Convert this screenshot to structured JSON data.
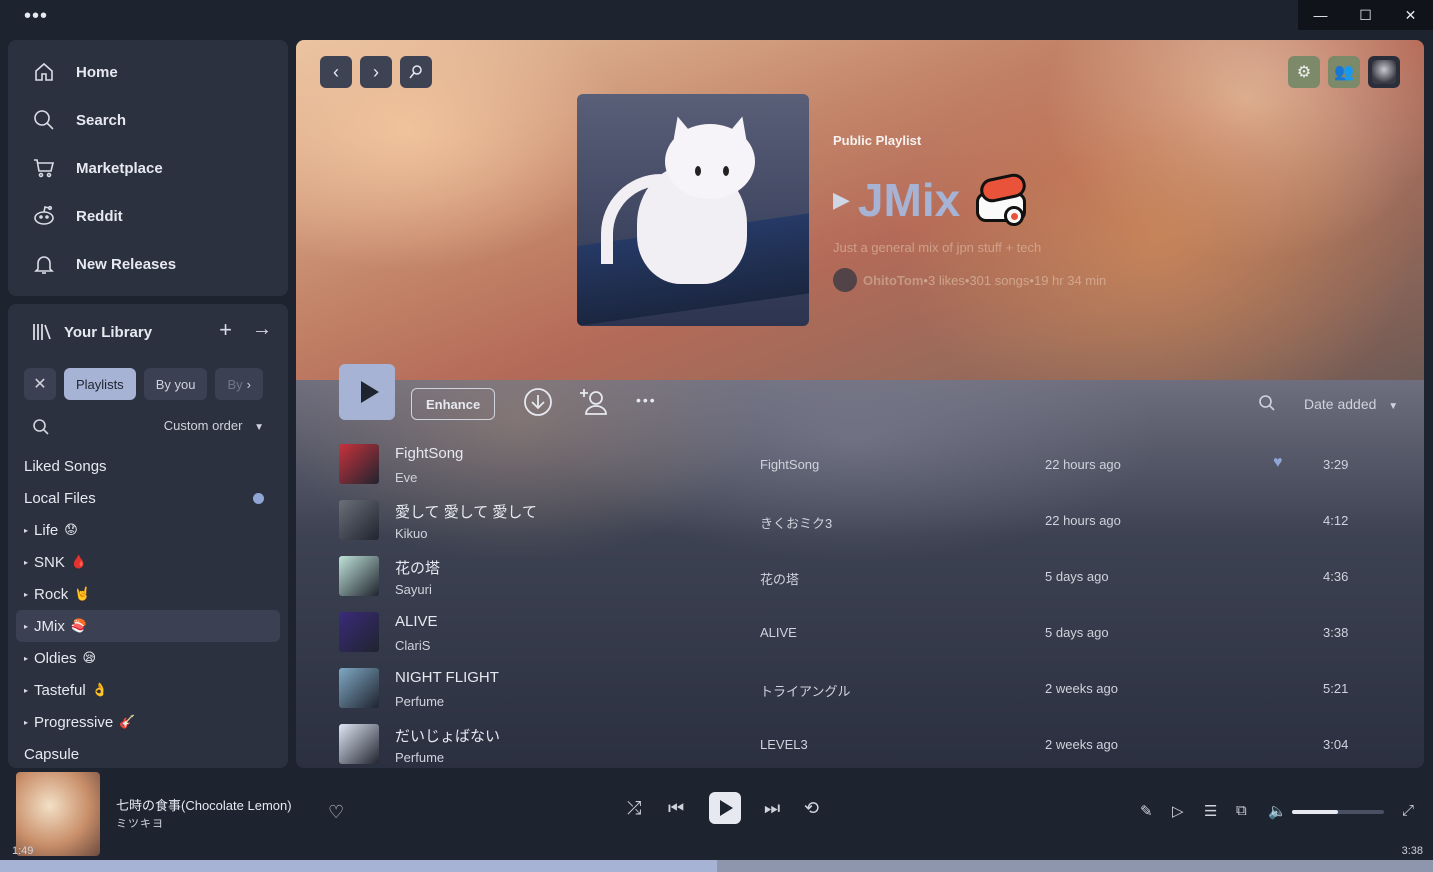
{
  "window": {
    "menu_dots": "•••",
    "minimize": "—",
    "maximize": "☐",
    "close": "✕"
  },
  "nav": [
    {
      "label": "Home",
      "icon": "home-icon"
    },
    {
      "label": "Search",
      "icon": "search-icon"
    },
    {
      "label": "Marketplace",
      "icon": "cart-icon"
    },
    {
      "label": "Reddit",
      "icon": "reddit-icon"
    },
    {
      "label": "New Releases",
      "icon": "bell-icon"
    }
  ],
  "library": {
    "title": "Your Library",
    "chips": {
      "clear": "✕",
      "playlists": "Playlists",
      "by_you": "By you",
      "by_more": "By"
    },
    "sort": "Custom order",
    "items": [
      {
        "label": "Liked Songs",
        "tri": "",
        "emoji": ""
      },
      {
        "label": "Local Files",
        "tri": "",
        "emoji": ""
      },
      {
        "label": "Life",
        "tri": "▸",
        "emoji": "😟"
      },
      {
        "label": "SNK",
        "tri": "▸",
        "emoji": "🩸"
      },
      {
        "label": "Rock",
        "tri": "▸",
        "emoji": "🤘"
      },
      {
        "label": "JMix",
        "tri": "▸",
        "emoji": "🍣"
      },
      {
        "label": "Oldies",
        "tri": "▸",
        "emoji": "😪"
      },
      {
        "label": "Tasteful",
        "tri": "▸",
        "emoji": "👌"
      },
      {
        "label": "Progressive",
        "tri": "▸",
        "emoji": "🎸"
      },
      {
        "label": "Capsule",
        "tri": "",
        "emoji": ""
      }
    ]
  },
  "playlist": {
    "type": "Public Playlist",
    "title": "JMix",
    "play_glyph": "▶",
    "description": "Just a general mix of jpn stuff + tech",
    "owner": "OhitoTom",
    "likes": "3 likes",
    "songs": "301 songs",
    "duration": "19 hr 34 min",
    "separator": " • "
  },
  "actions": {
    "enhance": "Enhance",
    "more": "•••",
    "sort": "Date added"
  },
  "tracks": [
    {
      "title": "FightSong",
      "artist": "Eve",
      "album": "FightSong",
      "added": "22 hours ago",
      "liked": true,
      "duration": "3:29",
      "color": "#c8323c"
    },
    {
      "title": "愛して 愛して 愛して",
      "artist": "Kikuo",
      "album": "きくおミク3",
      "added": "22 hours ago",
      "liked": false,
      "duration": "4:12",
      "color": "#6a6f78"
    },
    {
      "title": "花の塔",
      "artist": "Sayuri",
      "album": "花の塔",
      "added": "5 days ago",
      "liked": false,
      "duration": "4:36",
      "color": "#bfe3d8"
    },
    {
      "title": "ALIVE",
      "artist": "ClariS",
      "album": "ALIVE",
      "added": "5 days ago",
      "liked": false,
      "duration": "3:38",
      "color": "#3a2a7a"
    },
    {
      "title": "NIGHT FLIGHT",
      "artist": "Perfume",
      "album": "トライアングル",
      "added": "2 weeks ago",
      "liked": false,
      "duration": "5:21",
      "color": "#7fa8c4"
    },
    {
      "title": "だいじょばない",
      "artist": "Perfume",
      "album": "LEVEL3",
      "added": "2 weeks ago",
      "liked": false,
      "duration": "3:04",
      "color": "#dfe7f4"
    }
  ],
  "now_playing": {
    "title": "七時の食事(Chocolate Lemon)",
    "artist": "ミツキヨ",
    "elapsed": "1:49",
    "total": "3:38",
    "progress": 0.5,
    "volume": 0.5
  },
  "colors": {
    "accent": "#a7b3d4",
    "background": "#1e2330",
    "panel": "#2c3140"
  }
}
